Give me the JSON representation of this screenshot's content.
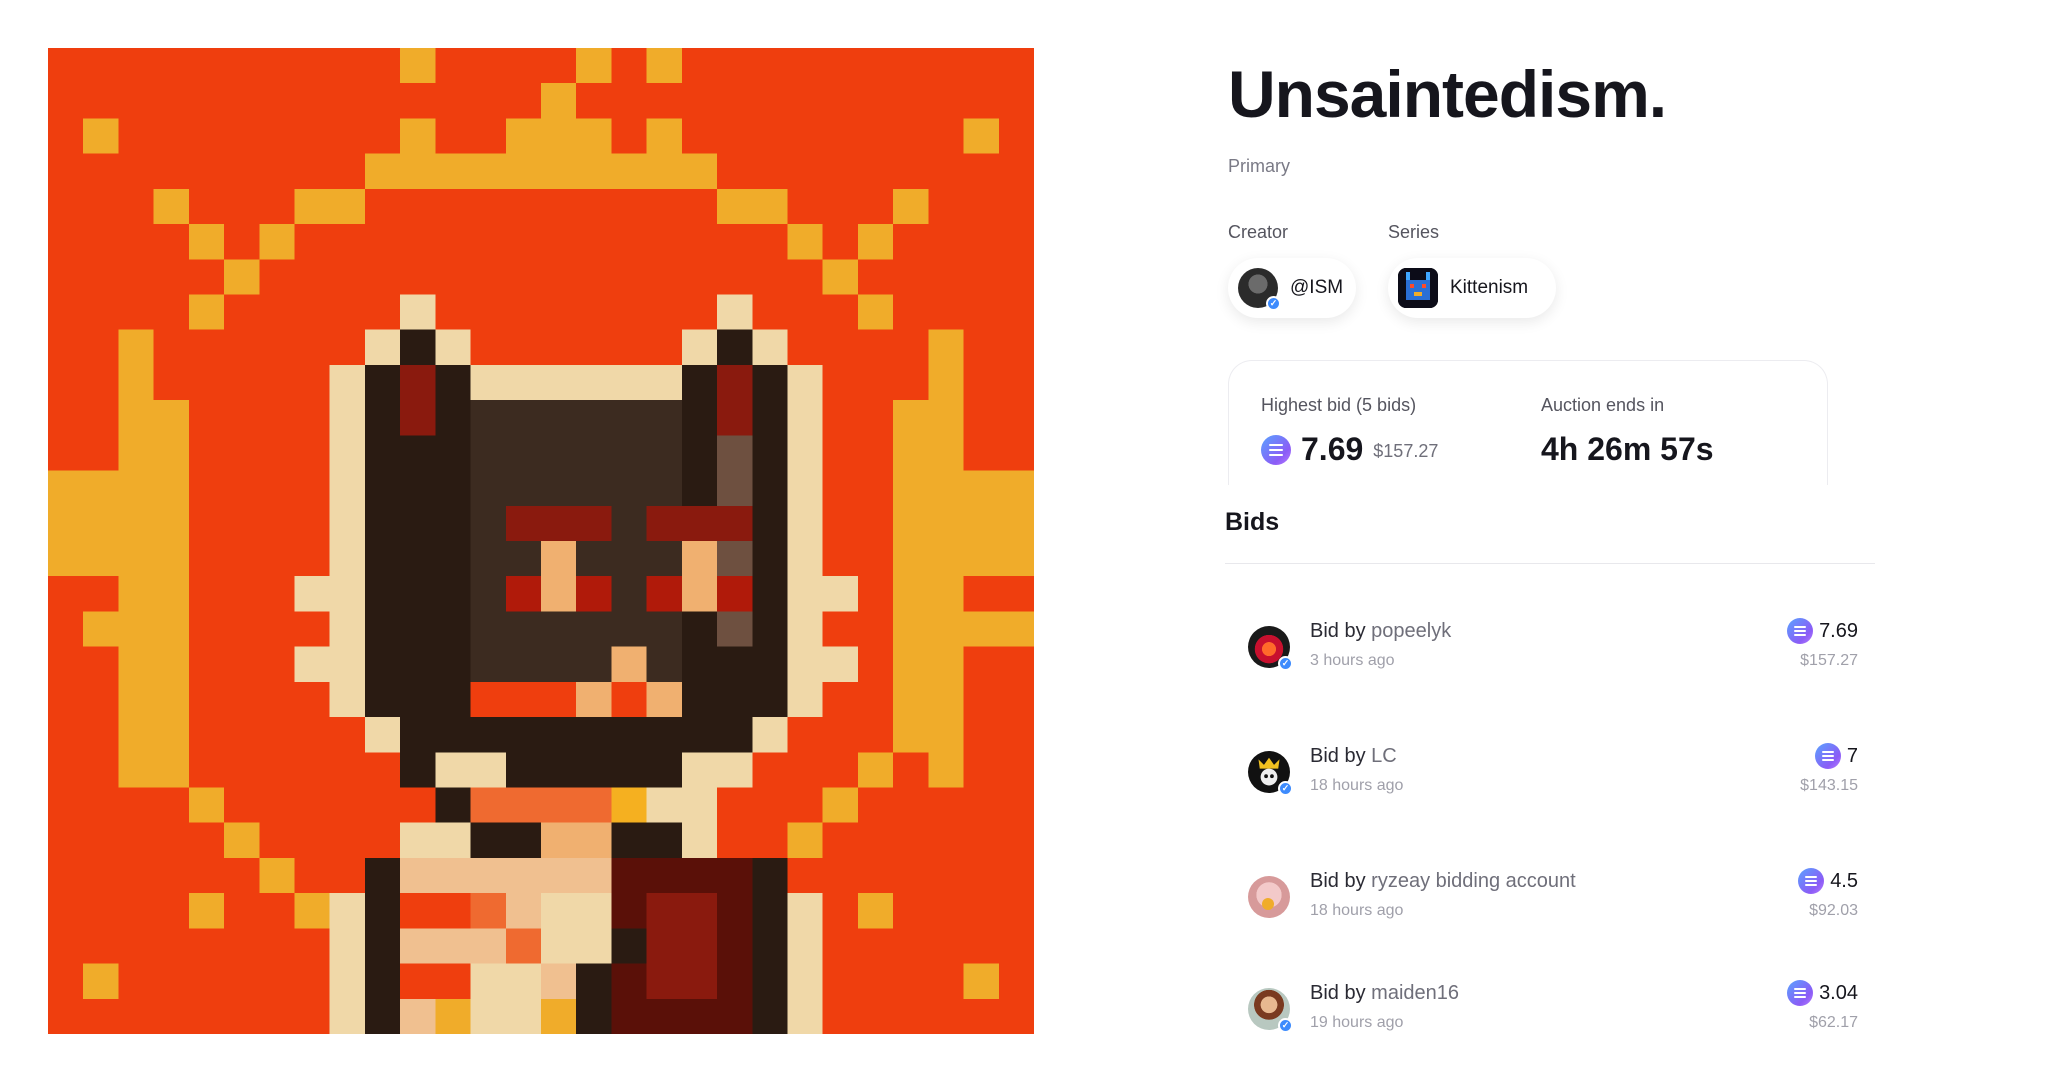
{
  "artwork": {
    "alt": "Pixel art of a dark cat with a crown of flames",
    "colors": {
      "background": "#ef3e0e",
      "gold": "#f0ac2a",
      "cream": "#f0d8a8",
      "dark": "#2a1b12",
      "brown": "#3c2b20",
      "red": "#8a1a0e"
    }
  },
  "title": "Unsaintedism.",
  "sale_type": "Primary",
  "creator": {
    "label": "Creator",
    "handle": "@ISM"
  },
  "series": {
    "label": "Series",
    "name": "Kittenism"
  },
  "auction": {
    "highest_bid_label": "Highest bid (5 bids)",
    "highest_bid_value": "7.69",
    "highest_bid_usd": "$157.27",
    "ends_label": "Auction ends in",
    "countdown": "4h 26m 57s"
  },
  "bids_title": "Bids",
  "bids": [
    {
      "prefix": "Bid by",
      "bidder": "popeelyk",
      "time": "3 hours ago",
      "amount": "7.69",
      "usd": "$157.27"
    },
    {
      "prefix": "Bid by",
      "bidder": "LC",
      "time": "18 hours ago",
      "amount": "7",
      "usd": "$143.15"
    },
    {
      "prefix": "Bid by",
      "bidder": "ryzeay bidding account",
      "time": "18 hours ago",
      "amount": "4.5",
      "usd": "$92.03"
    },
    {
      "prefix": "Bid by",
      "bidder": "maiden16",
      "time": "19 hours ago",
      "amount": "3.04",
      "usd": "$62.17"
    }
  ],
  "theme": {
    "accent": "#8b5cf6",
    "verified": "#3d8bfd"
  }
}
